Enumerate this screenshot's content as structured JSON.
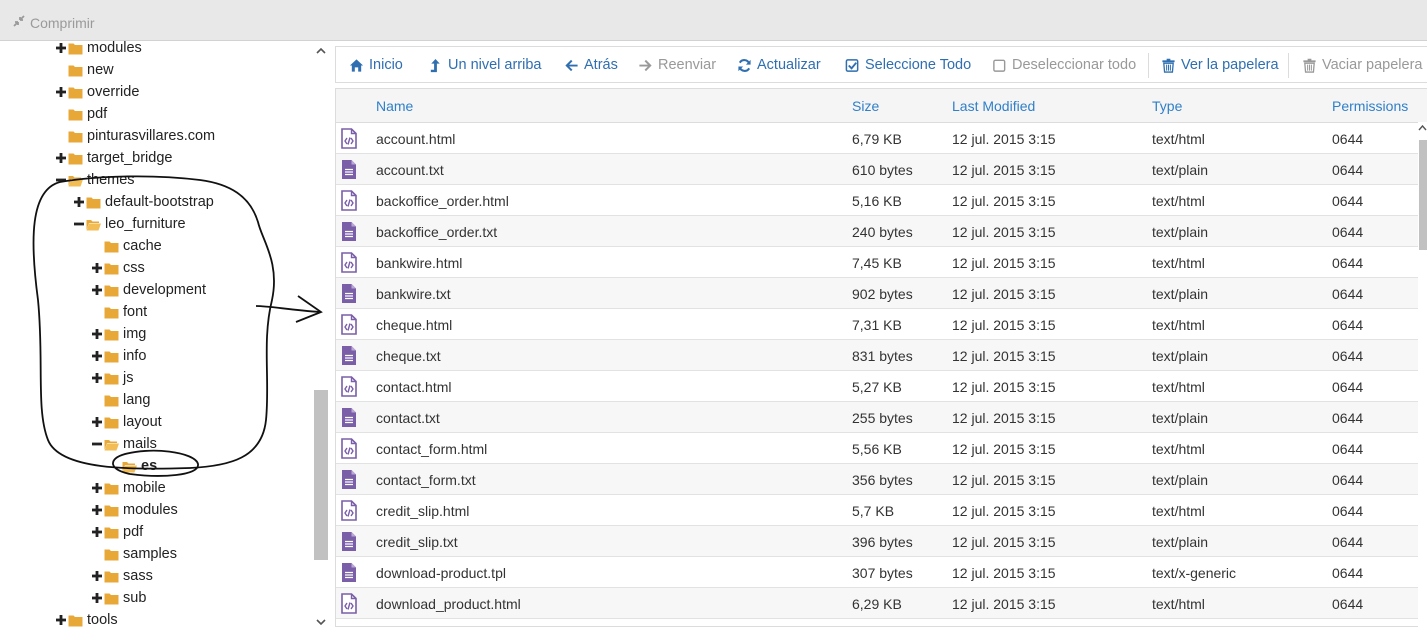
{
  "topbar": {
    "compress_label": "Comprimir",
    "compress_icon": "compress-icon"
  },
  "tree": {
    "items": [
      {
        "label": "modules",
        "toggle": "plus"
      },
      {
        "label": "new",
        "toggle": "none"
      },
      {
        "label": "override",
        "toggle": "plus"
      },
      {
        "label": "pdf",
        "toggle": "none"
      },
      {
        "label": "pinturasvillares.com",
        "toggle": "none"
      },
      {
        "label": "target_bridge",
        "toggle": "plus"
      },
      {
        "label": "themes",
        "toggle": "minus",
        "open": true
      },
      {
        "label": "default-bootstrap",
        "toggle": "plus"
      },
      {
        "label": "leo_furniture",
        "toggle": "minus",
        "open": true
      },
      {
        "label": "cache",
        "toggle": "none"
      },
      {
        "label": "css",
        "toggle": "plus"
      },
      {
        "label": "development",
        "toggle": "plus"
      },
      {
        "label": "font",
        "toggle": "none"
      },
      {
        "label": "img",
        "toggle": "plus"
      },
      {
        "label": "info",
        "toggle": "plus"
      },
      {
        "label": "js",
        "toggle": "plus"
      },
      {
        "label": "lang",
        "toggle": "none"
      },
      {
        "label": "layout",
        "toggle": "plus"
      },
      {
        "label": "mails",
        "toggle": "minus",
        "open": true
      },
      {
        "label": "es",
        "toggle": "none",
        "selected": true,
        "open": true
      },
      {
        "label": "mobile",
        "toggle": "plus"
      },
      {
        "label": "modules",
        "toggle": "plus"
      },
      {
        "label": "pdf",
        "toggle": "plus"
      },
      {
        "label": "samples",
        "toggle": "none"
      },
      {
        "label": "sass",
        "toggle": "plus"
      },
      {
        "label": "sub",
        "toggle": "plus"
      },
      {
        "label": "tools",
        "toggle": "plus"
      }
    ]
  },
  "toolbar": {
    "buttons": [
      {
        "label": "Inicio",
        "icon": "home-icon",
        "enabled": true
      },
      {
        "label": "Un nivel arriba",
        "icon": "level-up-icon",
        "enabled": true
      },
      {
        "label": "Atrás",
        "icon": "arrow-left-icon",
        "enabled": true
      },
      {
        "label": "Reenviar",
        "icon": "arrow-right-icon",
        "enabled": false
      },
      {
        "label": "Actualizar",
        "icon": "refresh-icon",
        "enabled": true
      },
      {
        "label": "Seleccione Todo",
        "icon": "checkbox-checked-icon",
        "enabled": true
      },
      {
        "label": "Deseleccionar todo",
        "icon": "checkbox-empty-icon",
        "enabled": false
      },
      {
        "label": "Ver la papelera",
        "icon": "trash-icon",
        "enabled": true
      },
      {
        "label": "Vaciar papelera",
        "icon": "trash-icon",
        "enabled": false
      }
    ]
  },
  "table": {
    "columns": [
      "Name",
      "Size",
      "Last Modified",
      "Type",
      "Permissions"
    ],
    "rows": [
      {
        "name": "account.html",
        "size": "6,79 KB",
        "modified": "12 jul. 2015 3:15",
        "type": "text/html",
        "perms": "0644",
        "icon": "html-file-icon"
      },
      {
        "name": "account.txt",
        "size": "610 bytes",
        "modified": "12 jul. 2015 3:15",
        "type": "text/plain",
        "perms": "0644",
        "icon": "text-file-icon"
      },
      {
        "name": "backoffice_order.html",
        "size": "5,16 KB",
        "modified": "12 jul. 2015 3:15",
        "type": "text/html",
        "perms": "0644",
        "icon": "html-file-icon"
      },
      {
        "name": "backoffice_order.txt",
        "size": "240 bytes",
        "modified": "12 jul. 2015 3:15",
        "type": "text/plain",
        "perms": "0644",
        "icon": "text-file-icon"
      },
      {
        "name": "bankwire.html",
        "size": "7,45 KB",
        "modified": "12 jul. 2015 3:15",
        "type": "text/html",
        "perms": "0644",
        "icon": "html-file-icon"
      },
      {
        "name": "bankwire.txt",
        "size": "902 bytes",
        "modified": "12 jul. 2015 3:15",
        "type": "text/plain",
        "perms": "0644",
        "icon": "text-file-icon"
      },
      {
        "name": "cheque.html",
        "size": "7,31 KB",
        "modified": "12 jul. 2015 3:15",
        "type": "text/html",
        "perms": "0644",
        "icon": "html-file-icon"
      },
      {
        "name": "cheque.txt",
        "size": "831 bytes",
        "modified": "12 jul. 2015 3:15",
        "type": "text/plain",
        "perms": "0644",
        "icon": "text-file-icon"
      },
      {
        "name": "contact.html",
        "size": "5,27 KB",
        "modified": "12 jul. 2015 3:15",
        "type": "text/html",
        "perms": "0644",
        "icon": "html-file-icon"
      },
      {
        "name": "contact.txt",
        "size": "255 bytes",
        "modified": "12 jul. 2015 3:15",
        "type": "text/plain",
        "perms": "0644",
        "icon": "text-file-icon"
      },
      {
        "name": "contact_form.html",
        "size": "5,56 KB",
        "modified": "12 jul. 2015 3:15",
        "type": "text/html",
        "perms": "0644",
        "icon": "html-file-icon"
      },
      {
        "name": "contact_form.txt",
        "size": "356 bytes",
        "modified": "12 jul. 2015 3:15",
        "type": "text/plain",
        "perms": "0644",
        "icon": "text-file-icon"
      },
      {
        "name": "credit_slip.html",
        "size": "5,7 KB",
        "modified": "12 jul. 2015 3:15",
        "type": "text/html",
        "perms": "0644",
        "icon": "html-file-icon"
      },
      {
        "name": "credit_slip.txt",
        "size": "396 bytes",
        "modified": "12 jul. 2015 3:15",
        "type": "text/plain",
        "perms": "0644",
        "icon": "text-file-icon"
      },
      {
        "name": "download-product.tpl",
        "size": "307 bytes",
        "modified": "12 jul. 2015 3:15",
        "type": "text/x-generic",
        "perms": "0644",
        "icon": "text-file-icon"
      },
      {
        "name": "download_product.html",
        "size": "6,29 KB",
        "modified": "12 jul. 2015 3:15",
        "type": "text/html",
        "perms": "0644",
        "icon": "html-file-icon"
      }
    ]
  },
  "colors": {
    "link": "#2f6fb0",
    "header_link": "#2f7fc9",
    "folder": "#e8a838",
    "file_icon": "#7a5ea8",
    "disabled": "#999999"
  }
}
